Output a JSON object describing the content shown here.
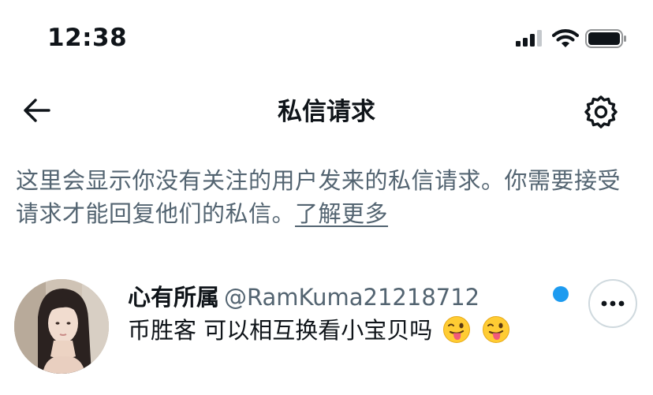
{
  "status_bar": {
    "time": "12:38",
    "icons": [
      "signal-icon",
      "wifi-icon",
      "battery-icon"
    ]
  },
  "header": {
    "title": "私信请求",
    "back_icon": "arrow-left-icon",
    "settings_icon": "gear-icon"
  },
  "description": {
    "text": "这里会显示你没有关注的用户发来的私信请求。你需要接受请求才能回复他们的私信。",
    "link_label": "了解更多"
  },
  "requests": [
    {
      "name": "心有所属",
      "handle": "@RamKuma21218712",
      "message": "币胜客 可以相互换看小宝贝吗",
      "emojis": [
        "winking-face-with-tongue-icon",
        "winking-face-with-tongue-icon"
      ],
      "unread": true,
      "more_icon": "more-dots-icon"
    }
  ],
  "colors": {
    "primary_text": "#0f1419",
    "secondary_text": "#536471",
    "accent_blue": "#1d9bf0",
    "border": "#cfd9de"
  }
}
